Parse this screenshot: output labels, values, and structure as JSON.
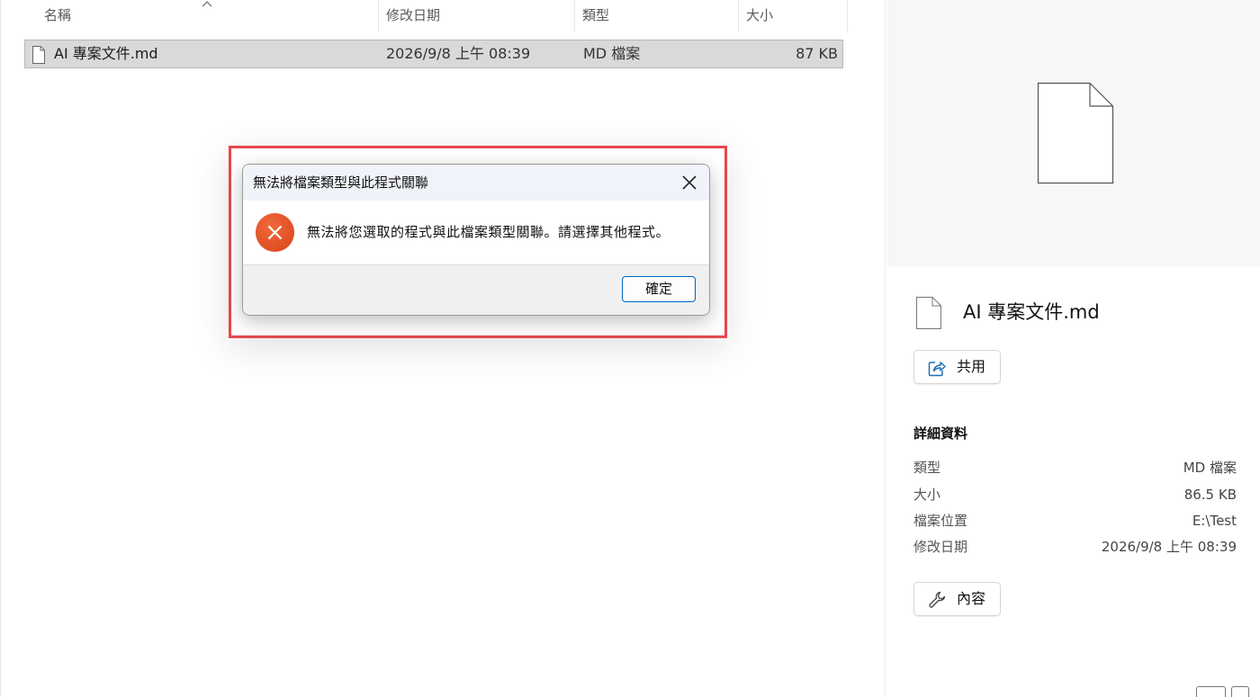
{
  "file_list": {
    "columns": {
      "name": "名稱",
      "date": "修改日期",
      "type": "類型",
      "size": "大小"
    },
    "row": {
      "name": "AI 專案文件.md",
      "date": "2026/9/8 上午 08:39",
      "type": "MD 檔案",
      "size": "87 KB"
    }
  },
  "dialog": {
    "title": "無法將檔案類型與此程式關聯",
    "message": "無法將您選取的程式與此檔案類型關聯。請選擇其他程式。",
    "ok_label": "確定"
  },
  "details": {
    "filename": "AI 專案文件.md",
    "share_label": "共用",
    "heading": "詳細資料",
    "rows": [
      {
        "key": "類型",
        "value": "MD 檔案"
      },
      {
        "key": "大小",
        "value": "86.5 KB"
      },
      {
        "key": "檔案位置",
        "value": "E:\\Test"
      },
      {
        "key": "修改日期",
        "value": "2026/9/8 上午 08:39"
      }
    ],
    "properties_label": "內容"
  },
  "colors": {
    "highlight": "#e5484d",
    "error_icon": "#e0501f",
    "accent": "#0067c0",
    "selected_row": "#d9d9d9"
  }
}
